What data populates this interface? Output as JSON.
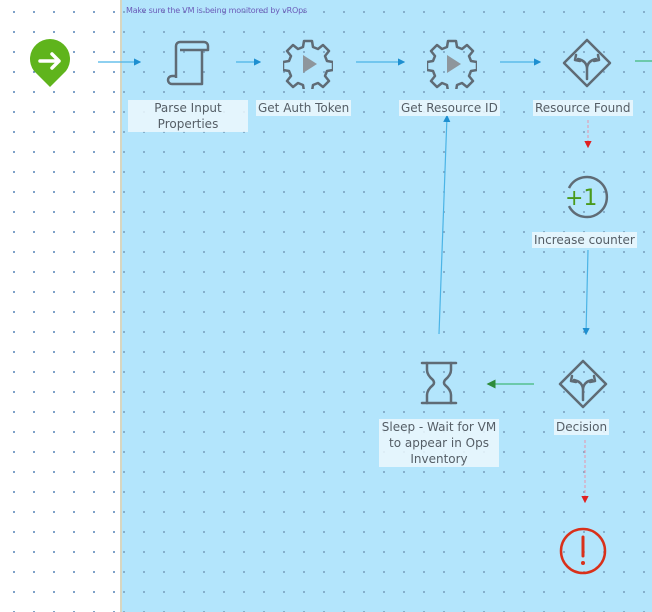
{
  "scope": {
    "note": "Make sure the VM is being monitored by vROps",
    "background_color": "#b3e5fc"
  },
  "colors": {
    "start": "#5fb41c",
    "icon_stroke": "#5f6b75",
    "normal_link": "#4bb4e6",
    "true_link": "#55c08f",
    "error_link": "#e0a0b8",
    "error_arrow": "#e02020",
    "error_end": "#d9301a",
    "counter": "#4a9a1c"
  },
  "nodes": {
    "start": {
      "type": "start",
      "icon": "arrow-right-icon"
    },
    "parse_input": {
      "type": "scriptable-task",
      "icon": "scroll-icon",
      "label": "Parse Input Properties"
    },
    "get_auth_token": {
      "type": "workflow",
      "icon": "gear-play-icon",
      "label": "Get Auth Token"
    },
    "get_resource_id": {
      "type": "workflow",
      "icon": "gear-play-icon",
      "label": "Get Resource ID"
    },
    "resource_found": {
      "type": "decision",
      "icon": "decision-diamond-icon",
      "label": "Resource Found"
    },
    "increase_counter": {
      "type": "increase-counter",
      "icon": "plus-one-icon",
      "icon_text": "+1",
      "label": "Increase counter"
    },
    "decision": {
      "type": "decision",
      "icon": "decision-diamond-icon",
      "label": "Decision"
    },
    "sleep": {
      "type": "sleep",
      "icon": "hourglass-icon",
      "label": "Sleep - Wait for VM to appear in Ops Inventory"
    },
    "error_end": {
      "type": "throw-exception",
      "icon": "exclamation-circle-icon"
    }
  }
}
